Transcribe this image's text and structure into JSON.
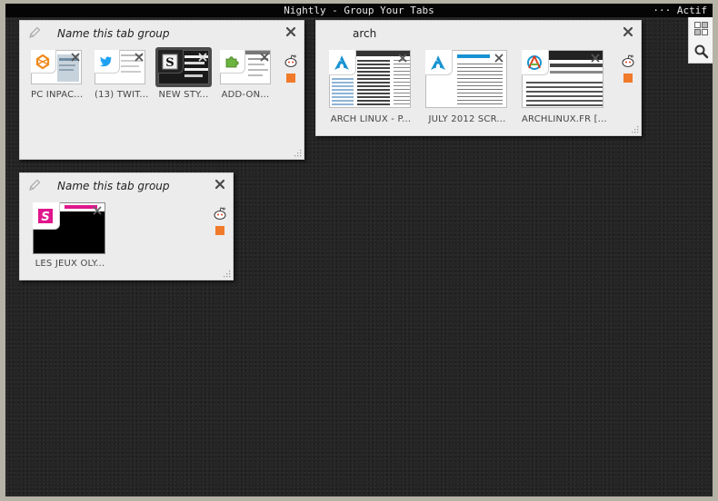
{
  "window": {
    "title": "Nightly - Group Your Tabs",
    "status": "··· Actif"
  },
  "groups": [
    {
      "name_placeholder": "Name this tab group",
      "tabs": [
        {
          "label": "PC INPAC..."
        },
        {
          "label": "(13) TWIT..."
        },
        {
          "label": "NEW STY..."
        },
        {
          "label": "ADD-ON..."
        }
      ]
    },
    {
      "name": "arch",
      "tabs": [
        {
          "label": "ARCH LINUX - P..."
        },
        {
          "label": "JULY 2012 SCR..."
        },
        {
          "label": "ARCHLINUX.FR [..."
        }
      ]
    },
    {
      "name_placeholder": "Name this tab group",
      "tabs": [
        {
          "label": "LES JEUX OLY..."
        }
      ]
    }
  ],
  "colors": {
    "twitter": "#1da1f2",
    "arch": "#1793d1",
    "orange": "#f07a2a",
    "magenta": "#e0168c",
    "stage": "#252525"
  }
}
